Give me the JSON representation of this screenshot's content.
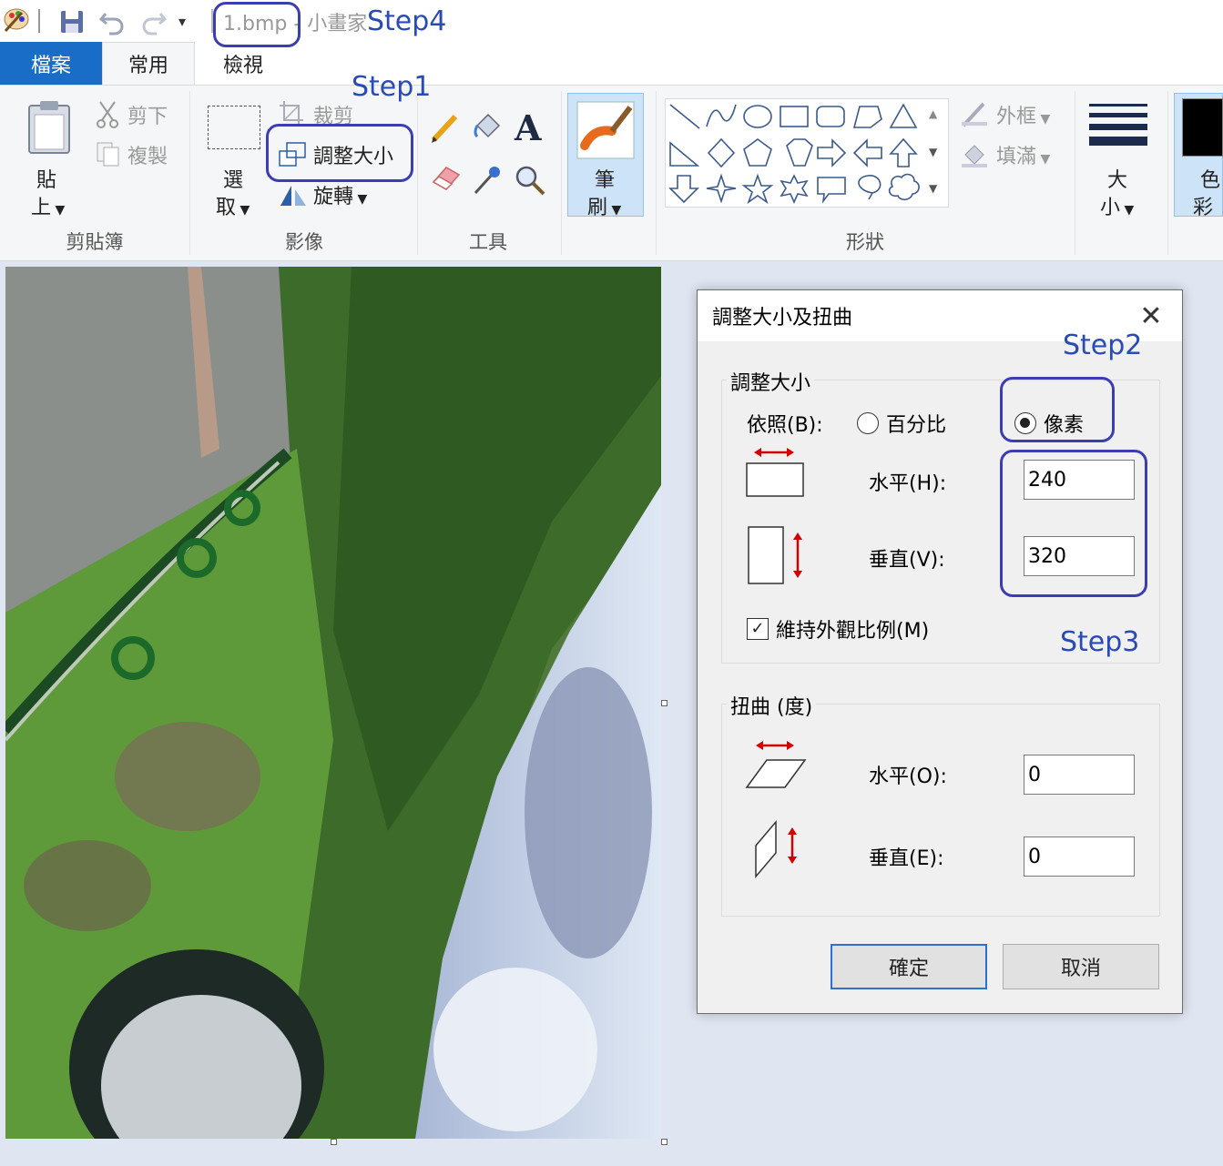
{
  "titlebar": {
    "file_name": "1.bmp",
    "app_name": " - 小畫家"
  },
  "tabs": {
    "file": "檔案",
    "home": "常用",
    "view": "檢視"
  },
  "ribbon": {
    "clipboard": {
      "paste_top": "貼",
      "paste_bottom": "上",
      "cut": "剪下",
      "copy": "複製",
      "label": "剪貼簿"
    },
    "image": {
      "select_top": "選",
      "select_bottom": "取",
      "crop": "裁剪",
      "resize": "調整大小",
      "rotate": "旋轉",
      "label": "影像"
    },
    "tools": {
      "text_glyph": "A",
      "label": "工具"
    },
    "brushes": {
      "top": "筆",
      "bottom": "刷"
    },
    "shapes": {
      "outline": "外框",
      "fill": "填滿",
      "label": "形狀"
    },
    "size": {
      "top": "大",
      "bottom": "小"
    },
    "colors": {
      "top": "色",
      "bottom": "彩"
    }
  },
  "dialog": {
    "title": "調整大小及扭曲",
    "close_glyph": "✕",
    "resize_section": "調整大小",
    "by_label": "依照(B):",
    "percent_label": "百分比",
    "pixels_label": "像素",
    "selected_mode": "pixels",
    "horizontal_label": "水平(H):",
    "horizontal_value": "240",
    "vertical_label": "垂直(V):",
    "vertical_value": "320",
    "maintain_aspect": "維持外觀比例(M)",
    "maintain_checked": true,
    "skew_section": "扭曲 (度)",
    "skew_h_label": "水平(O):",
    "skew_h_value": "0",
    "skew_v_label": "垂直(E):",
    "skew_v_value": "0",
    "ok": "確定",
    "cancel": "取消"
  },
  "annotations": {
    "step1": "Step1",
    "step2": "Step2",
    "step3": "Step3",
    "step4": "Step4"
  },
  "colors": {
    "accent": "#1a6dc6",
    "annotation": "#3d3db3",
    "arrow_red": "#d40000"
  }
}
